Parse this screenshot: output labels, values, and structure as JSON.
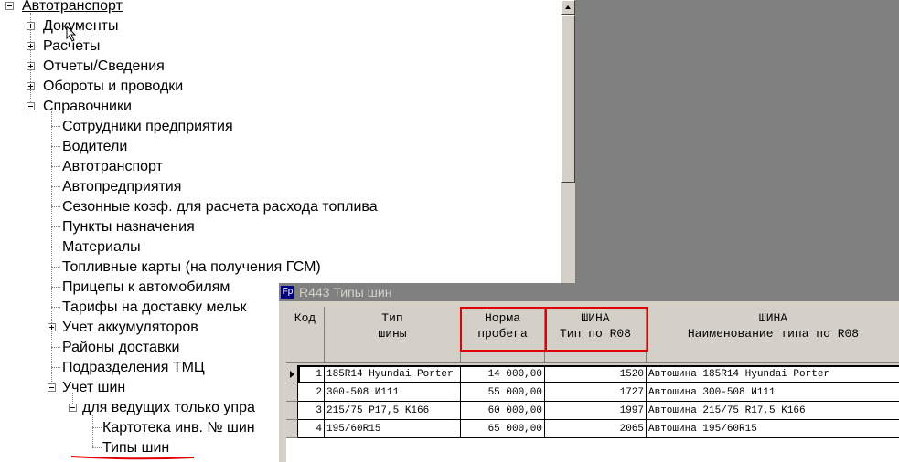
{
  "tree": {
    "root": "Автотранспорт",
    "items": [
      {
        "label": "Документы"
      },
      {
        "label": "Расчеты"
      },
      {
        "label": "Отчеты/Сведения"
      },
      {
        "label": "Обороты и проводки"
      },
      {
        "label": "Справочники"
      },
      {
        "label": "Сотрудники предприятия"
      },
      {
        "label": "Водители"
      },
      {
        "label": "Автотранспорт"
      },
      {
        "label": "Автопредприятия"
      },
      {
        "label": "Сезонные коэф. для расчета расхода топлива"
      },
      {
        "label": "Пункты назначения"
      },
      {
        "label": "Материалы"
      },
      {
        "label": "Топливные карты (на получения ГСМ)"
      },
      {
        "label": "Прицепы к автомобилям"
      },
      {
        "label": "Тарифы на доставку мельк"
      },
      {
        "label": "Учет аккумуляторов"
      },
      {
        "label": "Районы доставки"
      },
      {
        "label": "Подразделения ТМЦ"
      },
      {
        "label": "Учет шин"
      },
      {
        "label": "для ведущих только упра"
      },
      {
        "label": "Картотека инв. № шин"
      },
      {
        "label": "Типы шин"
      }
    ]
  },
  "window": {
    "icon_text": "Fp",
    "title": "R443 Типы шин"
  },
  "table": {
    "headers": {
      "kod": "Код",
      "tip_1": "Тип",
      "tip_2": "шины",
      "norma_1": "Норма",
      "norma_2": "пробега",
      "shina1_1": "ШИНА",
      "shina1_2": "Тип по R08",
      "shina2_1": "ШИНА",
      "shina2_2": "Наименование типа по R08"
    },
    "rows": [
      {
        "kod": "1",
        "tip": "185R14 Hyundai Porter",
        "norma": "14 000,00",
        "shina_tip": "1520",
        "shina_name": "Автошина 185R14 Hyundai Porter"
      },
      {
        "kod": "2",
        "tip": "300-508 И111",
        "norma": "55 000,00",
        "shina_tip": "1727",
        "shina_name": "Автошина 300-508 И111"
      },
      {
        "kod": "3",
        "tip": "215/75 P17,5 K166",
        "norma": "60 000,00",
        "shina_tip": "1997",
        "shina_name": "Автошина 215/75 R17,5 K166"
      },
      {
        "kod": "4",
        "tip": "195/60R15",
        "norma": "65 000,00",
        "shina_tip": "2065",
        "shina_name": "Автошина 195/60R15"
      }
    ]
  },
  "colors": {
    "highlight": "#e00000",
    "window_bg": "#d4d0c8",
    "desktop": "#808080"
  }
}
